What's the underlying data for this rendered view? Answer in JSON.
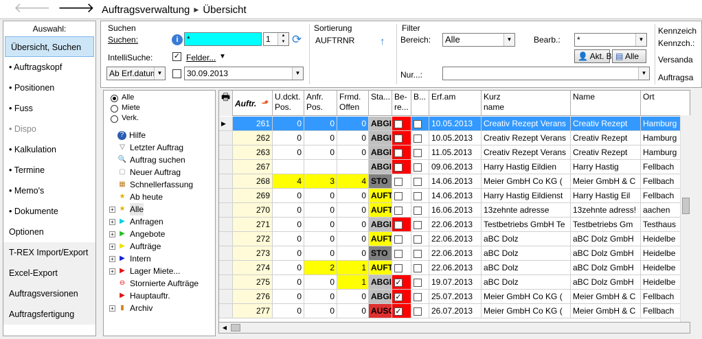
{
  "topbar": {
    "back_icon": "arrow-left-icon",
    "forward_icon": "arrow-right-icon",
    "crumbs": [
      "Auftragsverwaltung",
      "Übersicht"
    ]
  },
  "sidebar": {
    "header": "Auswahl:",
    "items": [
      {
        "label": "Übersicht, Suchen",
        "state": "active"
      },
      {
        "label": "• Auftragskopf",
        "state": "normal"
      },
      {
        "label": "• Positionen",
        "state": "normal"
      },
      {
        "label": "• Fuss",
        "state": "normal"
      },
      {
        "label": "• Dispo",
        "state": "disabled"
      },
      {
        "label": "• Kalkulation",
        "state": "normal"
      },
      {
        "label": "• Termine",
        "state": "normal"
      },
      {
        "label": "• Memo's",
        "state": "normal"
      },
      {
        "label": "• Dokumente",
        "state": "normal"
      },
      {
        "label": "Optionen",
        "state": "normal"
      },
      {
        "label": "T-REX Import/Export",
        "state": "grey"
      },
      {
        "label": "Excel-Export",
        "state": "grey"
      },
      {
        "label": "Auftragsversionen",
        "state": "grey"
      },
      {
        "label": "Auftragsfertigung",
        "state": "grey"
      }
    ]
  },
  "filter": {
    "search_group": "Suchen",
    "search_label": "Suchen:",
    "search_value": "*",
    "search_count": "1",
    "intelli_label": "IntelliSuche:",
    "felder_label": "Felder...",
    "felder_checked": "✓",
    "date_mode": "Ab Erf.datum",
    "date_value": "30.09.2013",
    "sort_group": "Sortierung",
    "sort_value": "AUFTRNR",
    "filter_group": "Filter",
    "bereich_label": "Bereich:",
    "bereich_value": "Alle",
    "bearb_label": "Bearb.:",
    "bearb_value": "*",
    "aktb_label": "Akt. B",
    "alle_label": "Alle",
    "nur_label": "Nur...:",
    "kenn_group": "Kennzeich",
    "kenn_label": "Kennzch.:",
    "versand_label": "Versanda",
    "auftragsa_label": "Auftragsa"
  },
  "tree": {
    "radios": [
      {
        "label": "Alle",
        "on": true
      },
      {
        "label": "Miete",
        "on": false
      },
      {
        "label": "Verk.",
        "on": false
      }
    ],
    "nodes": [
      {
        "label": "Hilfe",
        "icon": "help-icon",
        "color": "#2a5db0",
        "expand": false
      },
      {
        "label": "Letzter Auftrag",
        "icon": "funnel-icon",
        "color": "#666",
        "expand": false
      },
      {
        "label": "Auftrag suchen",
        "icon": "magnifier-icon",
        "color": "#666",
        "expand": false
      },
      {
        "label": "Neuer Auftrag",
        "icon": "new-document-icon",
        "color": "#999",
        "expand": false
      },
      {
        "label": "Schnellerfassung",
        "icon": "table-icon",
        "color": "#c08020",
        "expand": false
      },
      {
        "label": "Ab heute",
        "icon": "star-icon",
        "color": "#e0b000",
        "expand": false
      },
      {
        "label": "Alle",
        "icon": "star-icon",
        "color": "#e0b000",
        "expand": true
      },
      {
        "label": "Anfragen",
        "icon": "flag-cyan-icon",
        "color": "#00d0e0",
        "expand": true
      },
      {
        "label": "Angebote",
        "icon": "flag-green-icon",
        "color": "#20c020",
        "expand": true
      },
      {
        "label": "Aufträge",
        "icon": "flag-yellow-icon",
        "color": "#f0e000",
        "expand": true
      },
      {
        "label": "Intern",
        "icon": "flag-blue-icon",
        "color": "#1020d0",
        "expand": true
      },
      {
        "label": "Lager Miete...",
        "icon": "flag-red-icon",
        "color": "#e01010",
        "expand": true
      },
      {
        "label": "Stornierte Aufträge",
        "icon": "cancel-icon",
        "color": "#e01010",
        "expand": false
      },
      {
        "label": "Hauptauftr.",
        "icon": "flag-red-icon",
        "color": "#e01010",
        "expand": false
      },
      {
        "label": "Archiv",
        "icon": "archive-icon",
        "color": "#d08020",
        "expand": true
      }
    ]
  },
  "grid": {
    "headers": [
      "Auftr.",
      "U.dckt.\nPos.",
      "Anfr.\nPos.",
      "Frmd.\nOffen",
      "Sta...",
      "Be-\nre...",
      "B...",
      "Erf.am",
      "Kurz\nname",
      "Name",
      "Ort"
    ],
    "rows": [
      {
        "nr": "261",
        "udckt": "0",
        "anfr": "0",
        "frmd": "0",
        "status": "ABGI",
        "st_bg": "#c0c0c0",
        "bere": "",
        "bere_red": true,
        "b": "",
        "erf": "10.05.2013",
        "kurz": "Creativ Rezept Verans",
        "name": "Creativ Rezept",
        "ort": "Hamburg",
        "sel": true,
        "hl": false
      },
      {
        "nr": "262",
        "udckt": "0",
        "anfr": "0",
        "frmd": "0",
        "status": "ABGI",
        "st_bg": "#c0c0c0",
        "bere": "",
        "bere_red": true,
        "b": "",
        "erf": "10.05.2013",
        "kurz": "Creativ Rezept Verans",
        "name": "Creativ Rezept",
        "ort": "Hamburg",
        "sel": false,
        "hl": false
      },
      {
        "nr": "263",
        "udckt": "0",
        "anfr": "0",
        "frmd": "0",
        "status": "ABGI",
        "st_bg": "#c0c0c0",
        "bere": "",
        "bere_red": true,
        "b": "",
        "erf": "11.05.2013",
        "kurz": "Creativ Rezept Verans",
        "name": "Creativ Rezept",
        "ort": "Hamburg",
        "sel": false,
        "hl": false
      },
      {
        "nr": "267",
        "udckt": "",
        "anfr": "",
        "frmd": "",
        "status": "ABGI",
        "st_bg": "#c0c0c0",
        "bere": "",
        "bere_red": true,
        "b": "",
        "erf": "09.06.2013",
        "kurz": "Harry Hastig Eildien",
        "name": "Harry Hastig",
        "ort": "Fellbach",
        "sel": false,
        "hl": false
      },
      {
        "nr": "268",
        "udckt": "4",
        "anfr": "3",
        "frmd": "4",
        "status": "STO",
        "st_bg": "#808080",
        "bere": "",
        "bere_red": false,
        "b": "",
        "erf": "14.06.2013",
        "kurz": "Meier GmbH  Co KG (",
        "name": "Meier GmbH & C",
        "ort": "Fellbach",
        "sel": false,
        "hl": true
      },
      {
        "nr": "269",
        "udckt": "0",
        "anfr": "0",
        "frmd": "0",
        "status": "AUFT",
        "st_bg": "#ffff00",
        "bere": "",
        "bere_red": false,
        "b": "",
        "erf": "14.06.2013",
        "kurz": "Harry Hastig Eildienst",
        "name": "Harry Hastig Eil",
        "ort": "Fellbach",
        "sel": false,
        "hl": false
      },
      {
        "nr": "270",
        "udckt": "0",
        "anfr": "0",
        "frmd": "0",
        "status": "AUFT",
        "st_bg": "#ffff00",
        "bere": "",
        "bere_red": false,
        "b": "",
        "erf": "16.06.2013",
        "kurz": "13zehnte adresse",
        "name": "13zehnte adress!",
        "ort": "aachen",
        "sel": false,
        "hl": false
      },
      {
        "nr": "271",
        "udckt": "0",
        "anfr": "0",
        "frmd": "0",
        "status": "ABGI",
        "st_bg": "#c0c0c0",
        "bere": "",
        "bere_red": true,
        "b": "",
        "erf": "22.06.2013",
        "kurz": "Testbetriebs GmbH Te",
        "name": "Testbetriebs Gm",
        "ort": "Testhaus",
        "sel": false,
        "hl": false
      },
      {
        "nr": "272",
        "udckt": "0",
        "anfr": "0",
        "frmd": "0",
        "status": "AUFT",
        "st_bg": "#ffff00",
        "bere": "",
        "bere_red": false,
        "b": "",
        "erf": "22.06.2013",
        "kurz": "aBC Dolz",
        "name": "aBC Dolz GmbH",
        "ort": "Heidelbe",
        "sel": false,
        "hl": false
      },
      {
        "nr": "273",
        "udckt": "0",
        "anfr": "0",
        "frmd": "0",
        "status": "STO",
        "st_bg": "#808080",
        "bere": "",
        "bere_red": false,
        "b": "",
        "erf": "22.06.2013",
        "kurz": "aBC Dolz",
        "name": "aBC Dolz GmbH",
        "ort": "Heidelbe",
        "sel": false,
        "hl": false
      },
      {
        "nr": "274",
        "udckt": "0",
        "anfr": "2",
        "frmd": "1",
        "status": "AUFT",
        "st_bg": "#ffff00",
        "bere": "",
        "bere_red": false,
        "b": "",
        "erf": "22.06.2013",
        "kurz": "aBC Dolz",
        "name": "aBC Dolz GmbH",
        "ort": "Heidelbe",
        "sel": false,
        "hl": false,
        "hl_anfr": true
      },
      {
        "nr": "275",
        "udckt": "0",
        "anfr": "0",
        "frmd": "1",
        "status": "ABGI",
        "st_bg": "#c0c0c0",
        "bere": "✓",
        "bere_red": true,
        "b": "",
        "erf": "19.07.2013",
        "kurz": "aBC Dolz",
        "name": "aBC Dolz GmbH",
        "ort": "Heidelbe",
        "sel": false,
        "hl": false,
        "hl_frmd": true
      },
      {
        "nr": "276",
        "udckt": "0",
        "anfr": "0",
        "frmd": "0",
        "status": "ABGI",
        "st_bg": "#c0c0c0",
        "bere": "✓",
        "bere_red": true,
        "b": "",
        "erf": "25.07.2013",
        "kurz": "Meier GmbH  Co KG (",
        "name": "Meier GmbH & C",
        "ort": "Fellbach",
        "sel": false,
        "hl": false
      },
      {
        "nr": "277",
        "udckt": "0",
        "anfr": "0",
        "frmd": "0",
        "status": "AUSC",
        "st_bg": "#e03030",
        "bere": "✓",
        "bere_red": true,
        "b": "",
        "erf": "26.07.2013",
        "kurz": "Meier GmbH  Co KG (",
        "name": "Meier GmbH & C",
        "ort": "Fellbach",
        "sel": false,
        "hl": false
      }
    ]
  },
  "colors": {
    "accent": "#3399ff",
    "cyan_input": "#00ffff",
    "red": "#ff0000",
    "yellow": "#ffff00"
  }
}
